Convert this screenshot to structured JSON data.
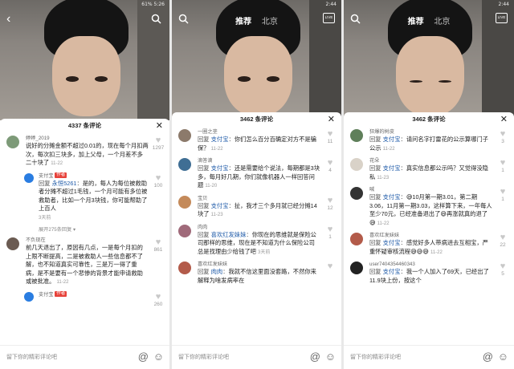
{
  "screens": [
    {
      "status_left": "",
      "status_right": "61% 5:26",
      "nav_tabs": [],
      "comment_count_label": "4337 条评论",
      "comments": [
        {
          "user": "婷婷_2019",
          "text": "说好的分摊金额不超过0.01的，现在每个月扣两次，每次扣三块多，加上父母，一个月差不多二十块了",
          "date": "11-22",
          "likes": "1297"
        },
        {
          "user": "支付宝",
          "tag": "作者",
          "reply_to": "永恒5261",
          "text": "是的，每人为每位被救助者分摊不超过1毛钱，一个月可能有多位被救助者，比如一个月3块钱，你可能帮助了上百人",
          "date": "3天前",
          "likes": "100"
        },
        {
          "more": "展开275条回复"
        },
        {
          "user": "不负现在",
          "text": "前几天退出了，原因有几点，一是每个月扣的上限不断提高，二是被救助人一些信息都不了解，也不知道真实可靠性，三是万一得了重病，是不是要有一个悲惨的背景才能申请救助或被批准。",
          "date": "11-22",
          "likes": "861"
        },
        {
          "user": "支付宝",
          "tag": "作者",
          "text": "",
          "date": "",
          "likes": "260"
        }
      ],
      "input_placeholder": "留下你的精彩评论吧"
    },
    {
      "status_left": "",
      "status_right": "2:44",
      "nav_tabs": [
        "推荐",
        "北京"
      ],
      "live_label": "LIVE",
      "comment_count_label": "3462 条评论",
      "comments": [
        {
          "user": "一圈之垄",
          "reply_to": "支付宝",
          "text": "你们怎么百分百确定对方不是骗保？",
          "date": "11-22",
          "likes": "11"
        },
        {
          "user": "滴答滴",
          "reply_to": "支付宝",
          "text": "还是需要给个说法，每期都是3块多，每月好几期，你们就像机器人一样回答问题",
          "date": "11-20",
          "likes": "4"
        },
        {
          "user": "宝贝",
          "reply_to": "支付宝",
          "text": "扯，我才三个多月就已经分摊14块了",
          "date": "11-23",
          "likes": "12"
        },
        {
          "user": "肉肉",
          "reply_to": "喜欢红发妹妹",
          "text": "你现在的思维就是保险公司那样的思维，现在是不知道为什么保险公司总是找理由少给钱了吧",
          "date": "3天前",
          "likes": "1"
        },
        {
          "user": "喜欢红发妹妹",
          "reply_to": "肉肉",
          "text": "我就不信这里面没套路，不然你来解释为啥发病率在",
          "date": "",
          "likes": ""
        }
      ],
      "input_placeholder": "留下你的精彩评论吧"
    },
    {
      "status_left": "",
      "status_right": "2:44",
      "nav_tabs": [
        "推荐",
        "北京"
      ],
      "live_label": "LIVE",
      "comment_count_label": "3462 条评论",
      "comments": [
        {
          "user": "狂爆的树皮",
          "reply_to": "支付宝",
          "text": "请问名字打雷花的公示算哪门子公示",
          "date": "11-22",
          "likes": "3"
        },
        {
          "user": "花朵",
          "reply_to": "支付宝",
          "text": "真实信息都公示吗？又觉得没隐私",
          "date": "11-23",
          "likes": "1"
        },
        {
          "user": "喊",
          "reply_to": "支付宝",
          "text": "😅10月第一期3.01，第二期3.06，11月第一期3.03，这样算下来，一年每人至少70元，已经准备退出了😅再涨就真的退了😅",
          "date": "11-22",
          "likes": "1"
        },
        {
          "user": "喜欢红发妹妹",
          "reply_to": "支付宝",
          "text": "感觉好多人带病进去互相宝，严重怀疑审核流程😅😅😅",
          "date": "11-22",
          "likes": "22"
        },
        {
          "user": "user7404354460343",
          "reply_to": "支付宝",
          "text": "我一个人加入了69天，已经出了11.9块上份，按这个",
          "date": "",
          "likes": "5"
        }
      ],
      "input_placeholder": "留下你的精彩评论吧"
    }
  ],
  "icons": {
    "heart": "heart-icon",
    "at": "at-icon",
    "emoji": "emoji-icon",
    "close": "close-icon",
    "search": "search-icon",
    "back": "back-arrow-icon"
  }
}
